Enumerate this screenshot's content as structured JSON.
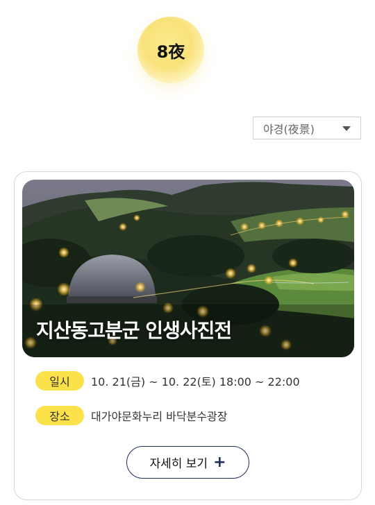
{
  "header": {
    "sun_label": "8夜"
  },
  "filter": {
    "selected": "야경(夜景)"
  },
  "card": {
    "title": "지산동고분군 인생사진전",
    "date_label": "일시",
    "date_value": "10. 21(금) ~ 10. 22(토) 18:00 ~ 22:00",
    "place_label": "장소",
    "place_value": "대가야문화누리 바닥분수광장",
    "more_label": "자세히 보기"
  },
  "colors": {
    "pill": "#fbe14a",
    "button_border": "#1c2e5a",
    "sun": "#f9e27a"
  }
}
